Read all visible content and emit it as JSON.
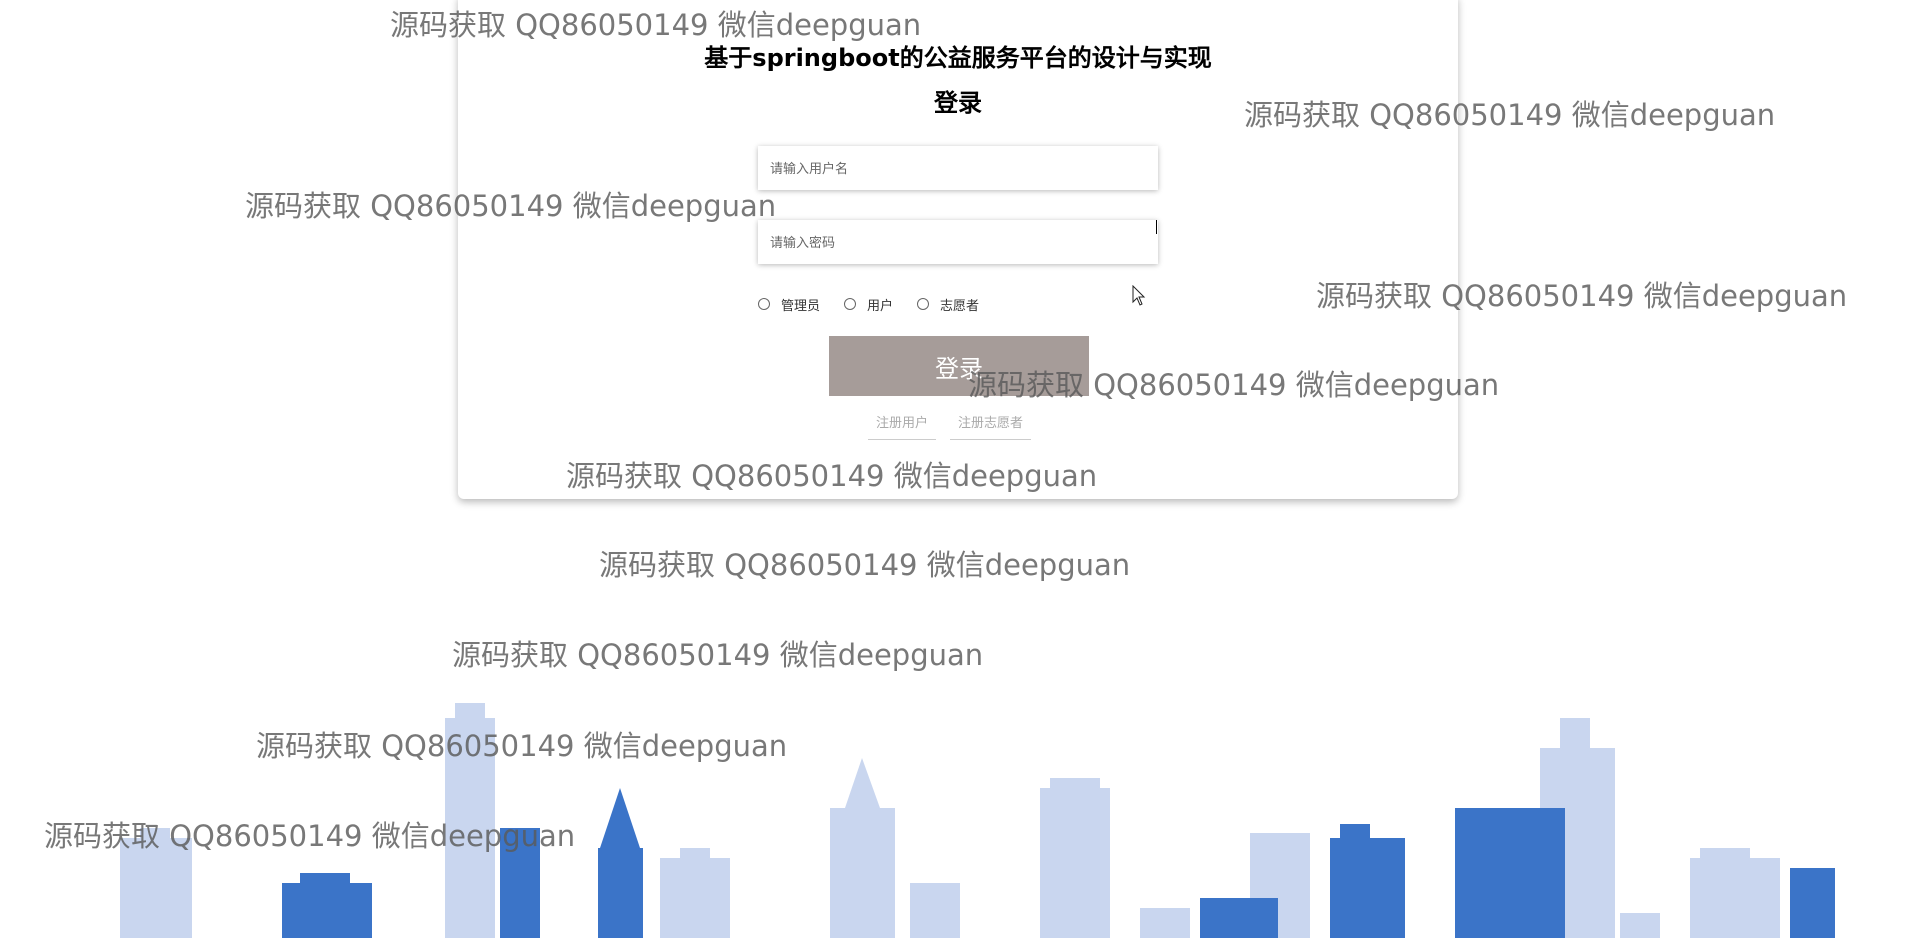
{
  "app": {
    "title": "基于springboot的公益服务平台的设计与实现",
    "login_heading": "登录"
  },
  "form": {
    "username_placeholder": "请输入用户名",
    "password_placeholder": "请输入密码",
    "roles": [
      "管理员",
      "用户",
      "志愿者"
    ],
    "login_button": "登录",
    "register_user": "注册用户",
    "register_volunteer": "注册志愿者"
  },
  "watermark": {
    "text": "源码获取 QQ86050149 微信deepguan"
  },
  "colors": {
    "button": "#a69c99",
    "skyline_light": "#c7d4ee",
    "skyline_dark": "#3a73c8"
  },
  "icons": {
    "cursor": "arrow-pointer-icon",
    "radio": "radio-circle-icon"
  }
}
